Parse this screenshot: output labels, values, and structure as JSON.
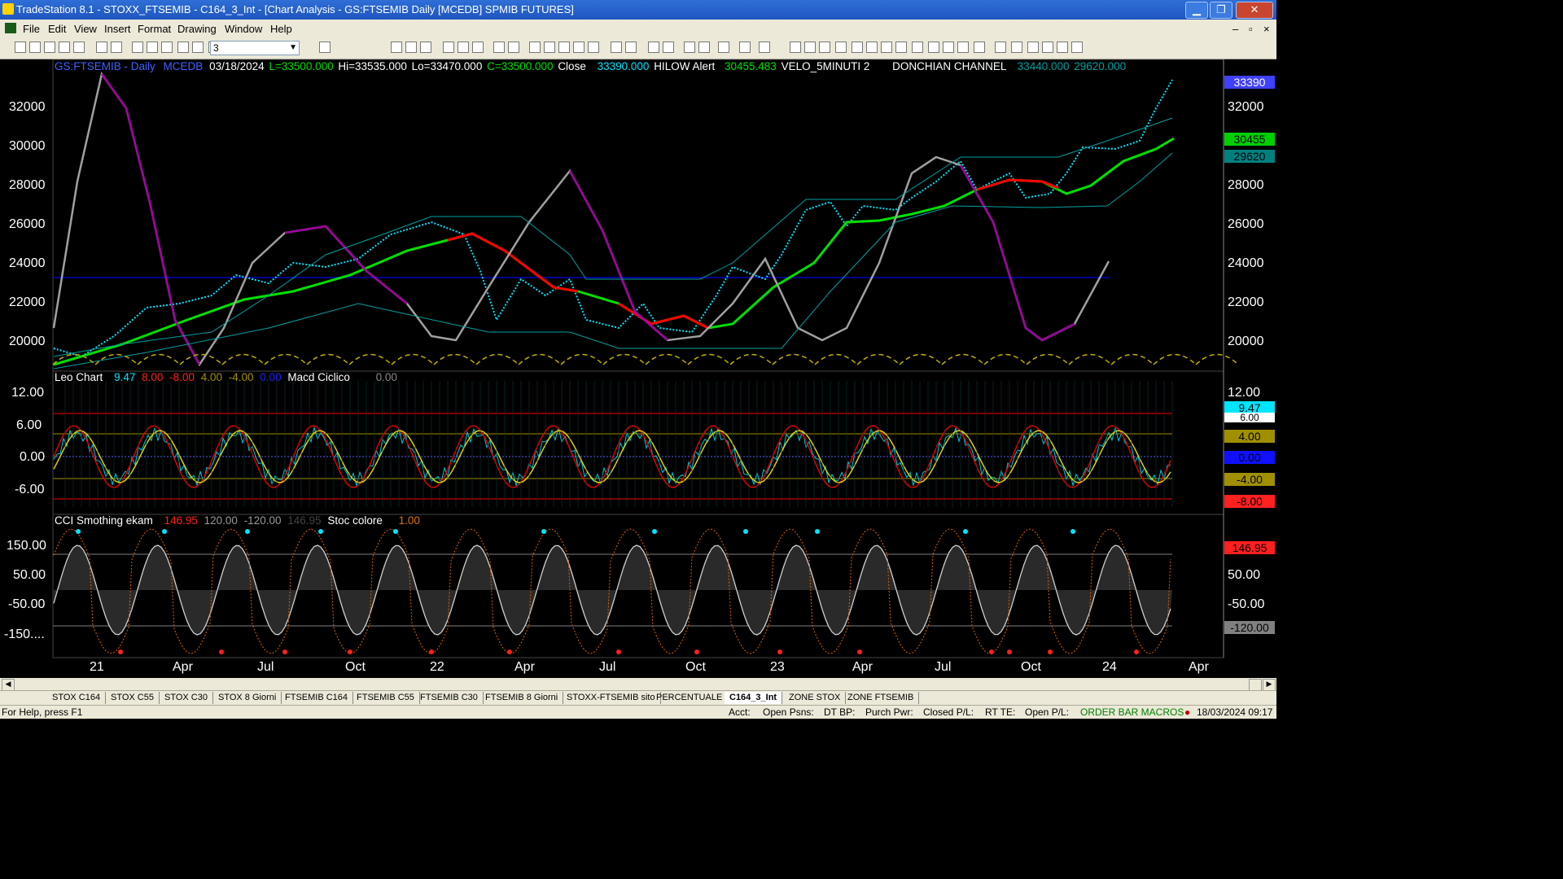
{
  "window": {
    "title": "TradeStation 8.1 - STOXX_FTSEMIB - C164_3_Int - [Chart Analysis - GS:FTSEMIB  Daily  [MCEDB] SPMIB FUTURES]",
    "min": "▁",
    "max": "❐",
    "close": "✕"
  },
  "menu": [
    "File",
    "Edit",
    "View",
    "Insert",
    "Format",
    "Drawing",
    "Window",
    "Help"
  ],
  "toolbar": {
    "combo_value": "3"
  },
  "header": {
    "symbol": "GS:FTSEMIB - Daily",
    "source": "MCEDB",
    "date": "03/18/2024",
    "last": "L=33500.000",
    "hi": "Hi=33535.000",
    "lo": "Lo=33470.000",
    "c": "C=33500.000",
    "close_label": "Close",
    "close_val": "33390.000",
    "hilow": "HILOW Alert",
    "hilow_val": "30455.483",
    "velo": "VELO_5MINUTI 2",
    "donchian": "DONCHIAN CHANNEL",
    "don_hi": "33440.000",
    "don_lo": "29620.000"
  },
  "panel1_axis": [
    "32000",
    "30000",
    "28000",
    "26000",
    "24000",
    "22000",
    "20000"
  ],
  "panel1_boxes": {
    "top": "33390",
    "b1": "30455",
    "b2": "29620"
  },
  "panel2": {
    "name": "Leo Chart",
    "v1": "9.47",
    "v2": "8.00",
    "v3": "-8.00",
    "v4": "4.00",
    "v5": "-4.00",
    "v6": "0.00",
    "macd": "Macd Ciclico",
    "macd_val": "0.00",
    "axis": [
      "12.00",
      "6.00",
      "0.00",
      "-6.00"
    ],
    "boxes": [
      "9.47",
      "8.00",
      "6.00",
      "4.00",
      "0.00",
      "-4.00",
      "-6.00",
      "-8.00"
    ]
  },
  "panel3": {
    "name": "CCI Smothing ekam",
    "v1": "146.95",
    "v2": "120.00",
    "v3": "-120.00",
    "v4": "146.95",
    "stoc": "Stoc colore",
    "stoc_val": "1.00",
    "axis": [
      "150.00",
      "50.00",
      "-50.00",
      "-150...."
    ],
    "boxes": [
      "146.95",
      "120.00",
      "50.00",
      "-50.00",
      "-120.00",
      "-150.00"
    ]
  },
  "xaxis": [
    "21",
    "Apr",
    "Jul",
    "Oct",
    "22",
    "Apr",
    "Jul",
    "Oct",
    "23",
    "Apr",
    "Jul",
    "Oct",
    "24",
    "Apr"
  ],
  "tabs": [
    "STOX C164",
    "STOX C55",
    "STOX  C30",
    "STOX  8 Giorni",
    "FTSEMIB C164",
    "FTSEMIB C55",
    "FTSEMIB C30",
    "FTSEMIB  8 Giorni",
    "STOXX-FTSEMIB sito",
    "PERCENTUALE",
    "C164_3_Int",
    "ZONE STOX",
    "ZONE FTSEMIB"
  ],
  "status": {
    "help": "For Help, press F1",
    "acct": "Acct:",
    "open_psns": "Open Psns:",
    "dtbp": "DT BP:",
    "purch": "Purch Pwr:",
    "closed": "Closed P/L:",
    "rtte": "RT TE:",
    "openpl": "Open P/L:",
    "order": "ORDER BAR  MACROS",
    "datetime": "18/03/2024 09:17"
  },
  "colors": {
    "price": "#00e5ff",
    "ma_up": "#00e000",
    "ma_down": "#ff0000",
    "cycle_up": "#a0a0a0",
    "cycle_down": "#a000a0",
    "donchian": "#00a0a0",
    "yellow": "#d4c800"
  }
}
